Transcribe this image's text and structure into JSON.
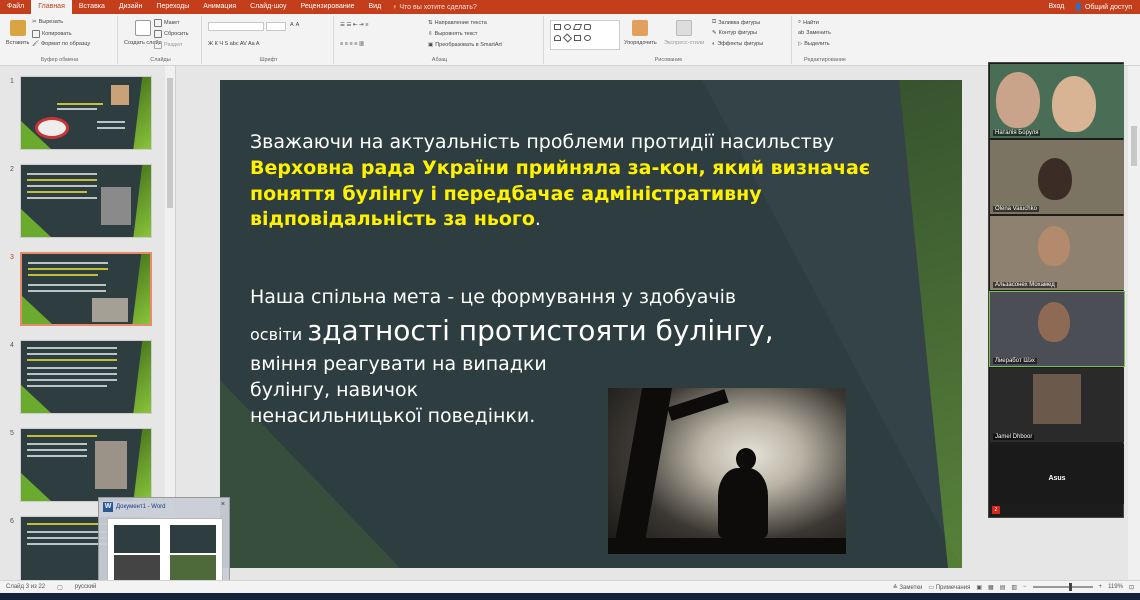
{
  "tabs": [
    "Файл",
    "Главная",
    "Вставка",
    "Дизайн",
    "Переходы",
    "Анимация",
    "Слайд-шоу",
    "Рецензирование",
    "Вид"
  ],
  "active_tab": "Главная",
  "tell_me": "Что вы хотите сделать?",
  "account": {
    "signin": "Вход",
    "share": "Общий доступ"
  },
  "ribbon": {
    "clipboard": {
      "paste": "Вставить",
      "cut": "Вырезать",
      "copy": "Копировать",
      "format_painter": "Формат по образцу",
      "group_name": "Буфер обмена"
    },
    "slides": {
      "new_slide": "Создать слайд",
      "layout": "Макет",
      "reset": "Сбросить",
      "section": "Раздел",
      "group_name": "Слайды"
    },
    "font": {
      "group_name": "Шрифт",
      "controls": "Ж  К  Ч  S  abc  AV  Aa  A"
    },
    "paragraph": {
      "text_direction": "Направление текста",
      "align_text": "Выровнять текст",
      "smartart": "Преобразовать в SmartArt",
      "group_name": "Абзац"
    },
    "drawing": {
      "arrange": "Упорядочить",
      "quick_styles": "Экспресс-стили",
      "fill": "Заливка фигуры",
      "outline": "Контур фигуры",
      "effects": "Эффекты фигуры",
      "group_name": "Рисование"
    },
    "editing": {
      "find": "Найти",
      "replace": "Заменить",
      "select": "Выделить",
      "group_name": "Редактирование"
    }
  },
  "thumbnails": [
    "1",
    "2",
    "3",
    "4",
    "5",
    "6"
  ],
  "selected_slide": 3,
  "slide": {
    "p1_a": "Зважаючи на актуальність проблеми протидії насильству ",
    "p1_hl": "Верховна рада України прийняла за-кон, який визначає поняття булінгу і передбачає адміністративну відповідальність за нього",
    "p1_end": ".",
    "p2_l1": "Наша спільна мета - це формування у здобуачів",
    "p2_l2_small": "освіти ",
    "p2_l2_big": "здатності протистояти булінгу,",
    "p2_l3": "вміння реагувати на випадки булінгу, навичок ненасильницької поведінки."
  },
  "participants": [
    "Наталія Боруля",
    "Olena Vaiuchko",
    "Альзасонех Мохамед",
    "Лиеработ Шэх",
    "Jamel Dhboor"
  ],
  "self_label": "Asus",
  "preview": {
    "title": "Документ1 - Word",
    "close": "×",
    "app_letter": "W"
  },
  "status": {
    "slide_info": "Слайд 3 из 22",
    "language": "русский",
    "notes": "Заметки",
    "comments": "Примечания",
    "zoom": "119%"
  },
  "colors": {
    "ribbon_accent": "#c43e1c",
    "slide_bg": "#2e3d40",
    "highlight_text": "#fff200",
    "green_accent": "#74b42f"
  }
}
